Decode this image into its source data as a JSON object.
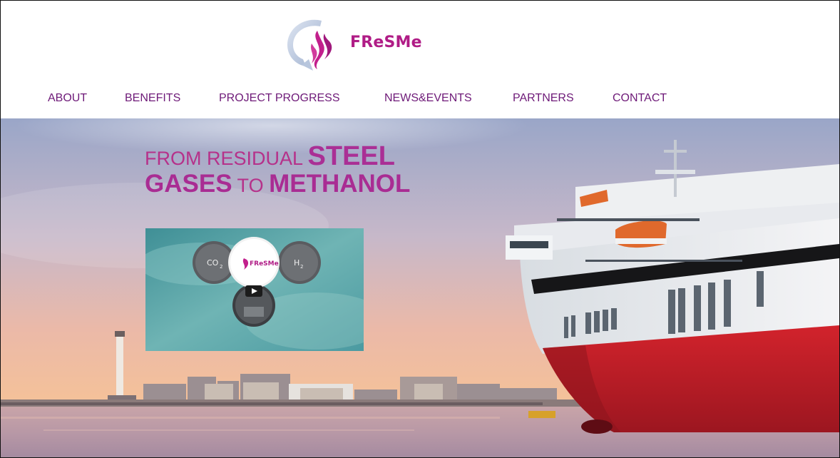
{
  "brand": {
    "name": "FReSMe"
  },
  "nav": {
    "items": [
      {
        "label": "ABOUT"
      },
      {
        "label": "BENEFITS"
      },
      {
        "label": "PROJECT PROGRESS"
      },
      {
        "label": "NEWS&EVENTS"
      },
      {
        "label": "PARTNERS"
      },
      {
        "label": "CONTACT"
      }
    ]
  },
  "hero": {
    "line1_a": "FROM RESIDUAL ",
    "line1_b": "STEEL",
    "line2_a": "GASES",
    "line2_b": " TO ",
    "line2_c": "METHANOL"
  },
  "video": {
    "brand": "FReSMe",
    "left_bubble": "CO",
    "left_sub": "2",
    "right_bubble": "H",
    "right_sub": "2"
  },
  "colors": {
    "brand": "#b01c86",
    "nav": "#6e1a78",
    "hull_red": "#c71f28"
  },
  "icons": [
    "logo-icon",
    "play-icon",
    "chimney-icon"
  ]
}
